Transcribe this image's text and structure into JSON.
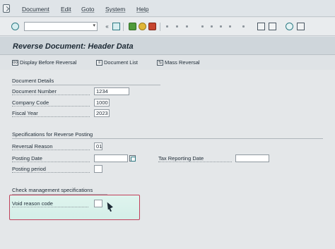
{
  "menu": {
    "items": [
      "Document",
      "Edit",
      "Goto",
      "System",
      "Help"
    ]
  },
  "toolbar": {
    "command_field_value": "",
    "command_field_placeholder": "",
    "icons": [
      "enter-icon",
      "save-icon",
      "back-icon",
      "exit-icon",
      "cancel-icon",
      "print-icon",
      "find-icon",
      "find-next-icon",
      "first-page-icon",
      "prev-page-icon",
      "next-page-icon",
      "last-page-icon",
      "create-session-icon",
      "shortcut-icon",
      "help-icon",
      "customize-layout-icon"
    ]
  },
  "screen": {
    "title": "Reverse Document: Header Data"
  },
  "app_toolbar": {
    "display_before_reversal": "Display Before Reversal",
    "document_list": "Document List",
    "mass_reversal": "Mass Reversal"
  },
  "document_details": {
    "title": "Document Details",
    "document_number_label": "Document Number",
    "document_number_value": "1234",
    "company_code_label": "Company Code",
    "company_code_value": "1000",
    "fiscal_year_label": "Fiscal Year",
    "fiscal_year_value": "2023"
  },
  "reverse_posting": {
    "title": "Specifications for Reverse Posting",
    "reversal_reason_label": "Reversal Reason",
    "reversal_reason_value": "01",
    "posting_date_label": "Posting Date",
    "posting_date_value": "",
    "posting_period_label": "Posting period",
    "posting_period_value": "",
    "tax_reporting_date_label": "Tax Reporting Date",
    "tax_reporting_date_value": ""
  },
  "check_management": {
    "title": "Check management specifications",
    "void_reason_code_label": "Void reason code",
    "void_reason_code_value": ""
  },
  "colors": {
    "highlight_border": "#c2405a",
    "highlight_fill": "#d4efe8",
    "title_bar": "#cfd6db"
  }
}
